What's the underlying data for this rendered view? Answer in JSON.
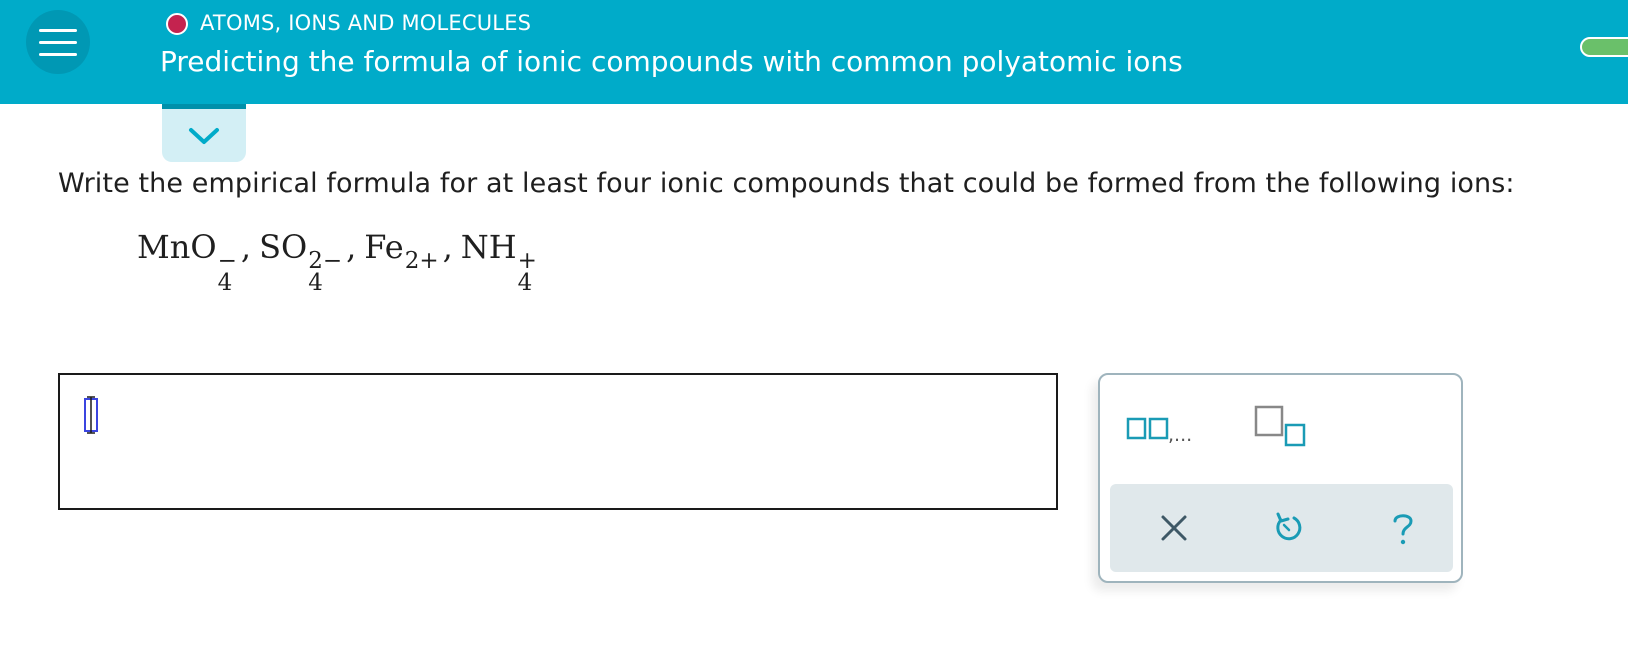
{
  "header": {
    "topic": "ATOMS, IONS AND MOLECULES",
    "title": "Predicting the formula of ionic compounds with common polyatomic ions",
    "colors": {
      "bar": "#00abc9",
      "topic_dot": "#c4234f",
      "progress": "#6ac06a"
    }
  },
  "question": {
    "prompt": "Write the empirical formula for at least four ionic compounds that could be formed from the following ions:",
    "ions": [
      {
        "base": "MnO",
        "sub": "4",
        "sup": "−"
      },
      {
        "base": "SO",
        "sub": "4",
        "sup": "2−"
      },
      {
        "base": "Fe",
        "sub": "",
        "sup": "2+"
      },
      {
        "base": "NH",
        "sub": "4",
        "sup": "+"
      }
    ],
    "separator": ","
  },
  "palette": {
    "list_label": ",..."
  },
  "icons": {
    "menu": "hamburger-icon",
    "collapse": "chevron-down-icon",
    "list_template": "list-template-icon",
    "subscript_template": "subscript-template-icon",
    "clear": "close-icon",
    "undo": "undo-icon",
    "help": "help-icon"
  }
}
